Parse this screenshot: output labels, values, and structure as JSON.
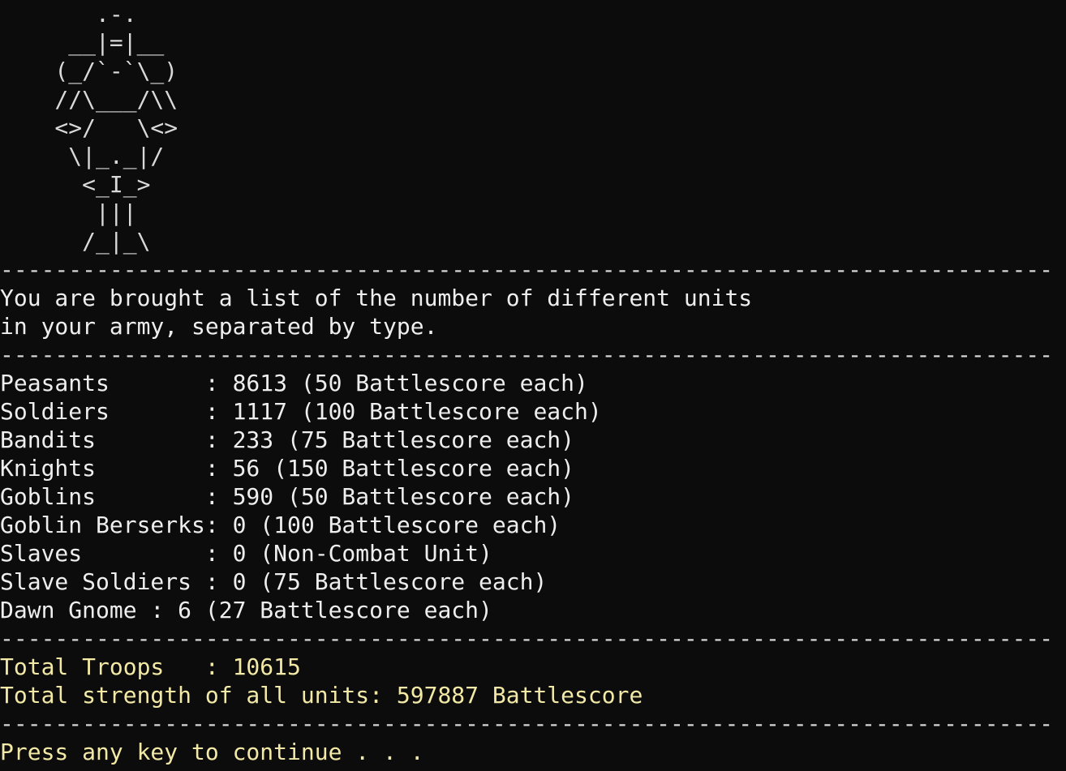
{
  "ascii_art": [
    "       .-.",
    "     __|=|__",
    "    (_/`-`\\_)",
    "    //\\___/\\\\",
    "    <>/   \\<>",
    "     \\|_._|/",
    "      <_I_>",
    "       |||",
    "      /_|_\\"
  ],
  "divider": "-----------------------------------------------------------------------------",
  "intro_lines": [
    "You are brought a list of the number of different units",
    "in your army, separated by type."
  ],
  "units": [
    "Peasants       : 8613 (50 Battlescore each)",
    "Soldiers       : 1117 (100 Battlescore each)",
    "Bandits        : 233 (75 Battlescore each)",
    "Knights        : 56 (150 Battlescore each)",
    "Goblins        : 590 (50 Battlescore each)",
    "Goblin Berserks: 0 (100 Battlescore each)",
    "Slaves         : 0 (Non-Combat Unit)",
    "Slave Soldiers : 0 (75 Battlescore each)",
    "Dawn Gnome : 6 (27 Battlescore each)"
  ],
  "totals": {
    "troops": "Total Troops   : 10615",
    "strength": "Total strength of all units: 597887 Battlescore"
  },
  "prompt": "Press any key to continue . . .",
  "colors": {
    "background": "#0c0c0c",
    "text": "#eeeeee",
    "highlight": "#f3e9a6"
  }
}
